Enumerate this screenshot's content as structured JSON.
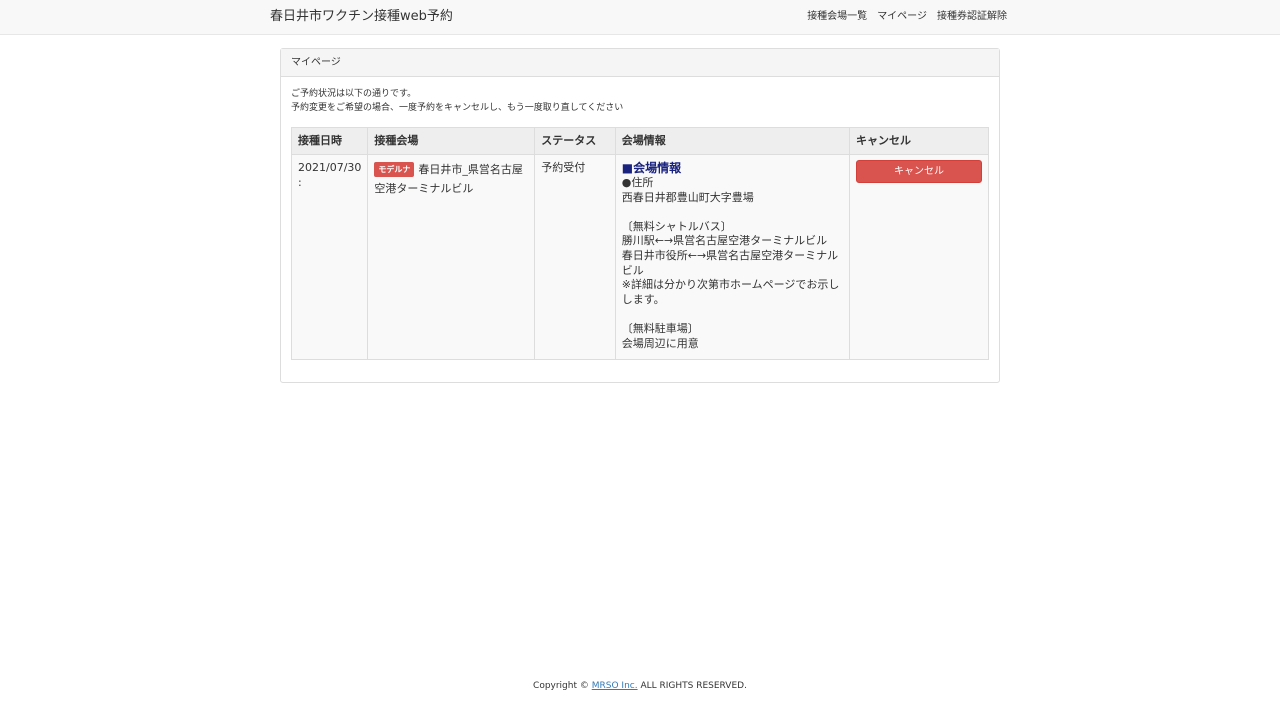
{
  "navbar": {
    "brand": "春日井市ワクチン接種web予約",
    "links": [
      "接種会場一覧",
      "マイページ",
      "接種券認証解除"
    ]
  },
  "panel": {
    "heading": "マイページ",
    "intro_line1": "ご予約状況は以下の通りです。",
    "intro_line2": "予約変更をご希望の場合、一度予約をキャンセルし、もう一度取り直してください"
  },
  "table": {
    "headers": [
      "接種日時",
      "接種会場",
      "ステータス",
      "会場情報",
      "キャンセル"
    ],
    "row": {
      "date_line1": "2021/07/30",
      "date_line2": ":",
      "vaccine_badge": "モデルナ",
      "venue": "春日井市_県営名古屋空港ターミナルビル",
      "status": "予約受付",
      "info_title": "■会場情報",
      "info_body": "●住所\n西春日井郡豊山町大字豊場\n\n〔無料シャトルバス〕\n勝川駅←→県営名古屋空港ターミナルビル\n春日井市役所←→県営名古屋空港ターミナルビル\n※詳細は分かり次第市ホームページでお示しします。\n\n〔無料駐車場〕\n会場周辺に用意",
      "cancel_label": "キャンセル"
    }
  },
  "footer": {
    "prefix": "Copyright © ",
    "company": "MRSO Inc.",
    "suffix": " ALL RIGHTS RESERVED."
  }
}
